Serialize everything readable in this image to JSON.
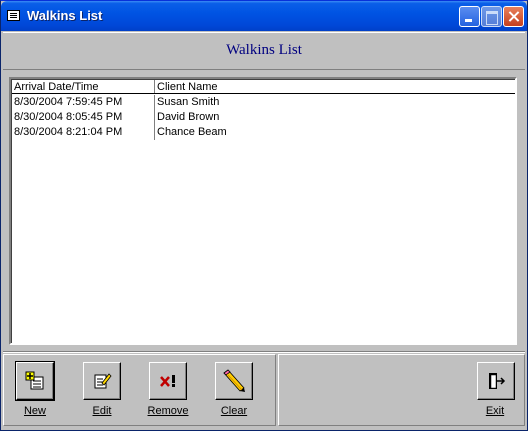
{
  "window": {
    "title": "Walkins List"
  },
  "header": {
    "title": "Walkins List"
  },
  "list": {
    "columns": [
      "Arrival Date/Time",
      "Client Name"
    ],
    "rows": [
      {
        "arrival": "8/30/2004 7:59:45 PM",
        "client": "Susan Smith"
      },
      {
        "arrival": "8/30/2004 8:05:45 PM",
        "client": "David Brown"
      },
      {
        "arrival": "8/30/2004 8:21:04 PM",
        "client": "Chance Beam"
      }
    ]
  },
  "buttons": {
    "new": {
      "label": "New",
      "icon": "new-record-icon"
    },
    "edit": {
      "label": "Edit",
      "icon": "edit-record-icon"
    },
    "remove": {
      "label": "Remove",
      "icon": "remove-icon"
    },
    "clear": {
      "label": "Clear",
      "icon": "pencil-eraser-icon"
    },
    "exit": {
      "label": "Exit",
      "icon": "exit-door-icon"
    }
  },
  "colors": {
    "titlebar": "#0054e3",
    "header_text": "#000080",
    "face": "#c0c0c0"
  }
}
